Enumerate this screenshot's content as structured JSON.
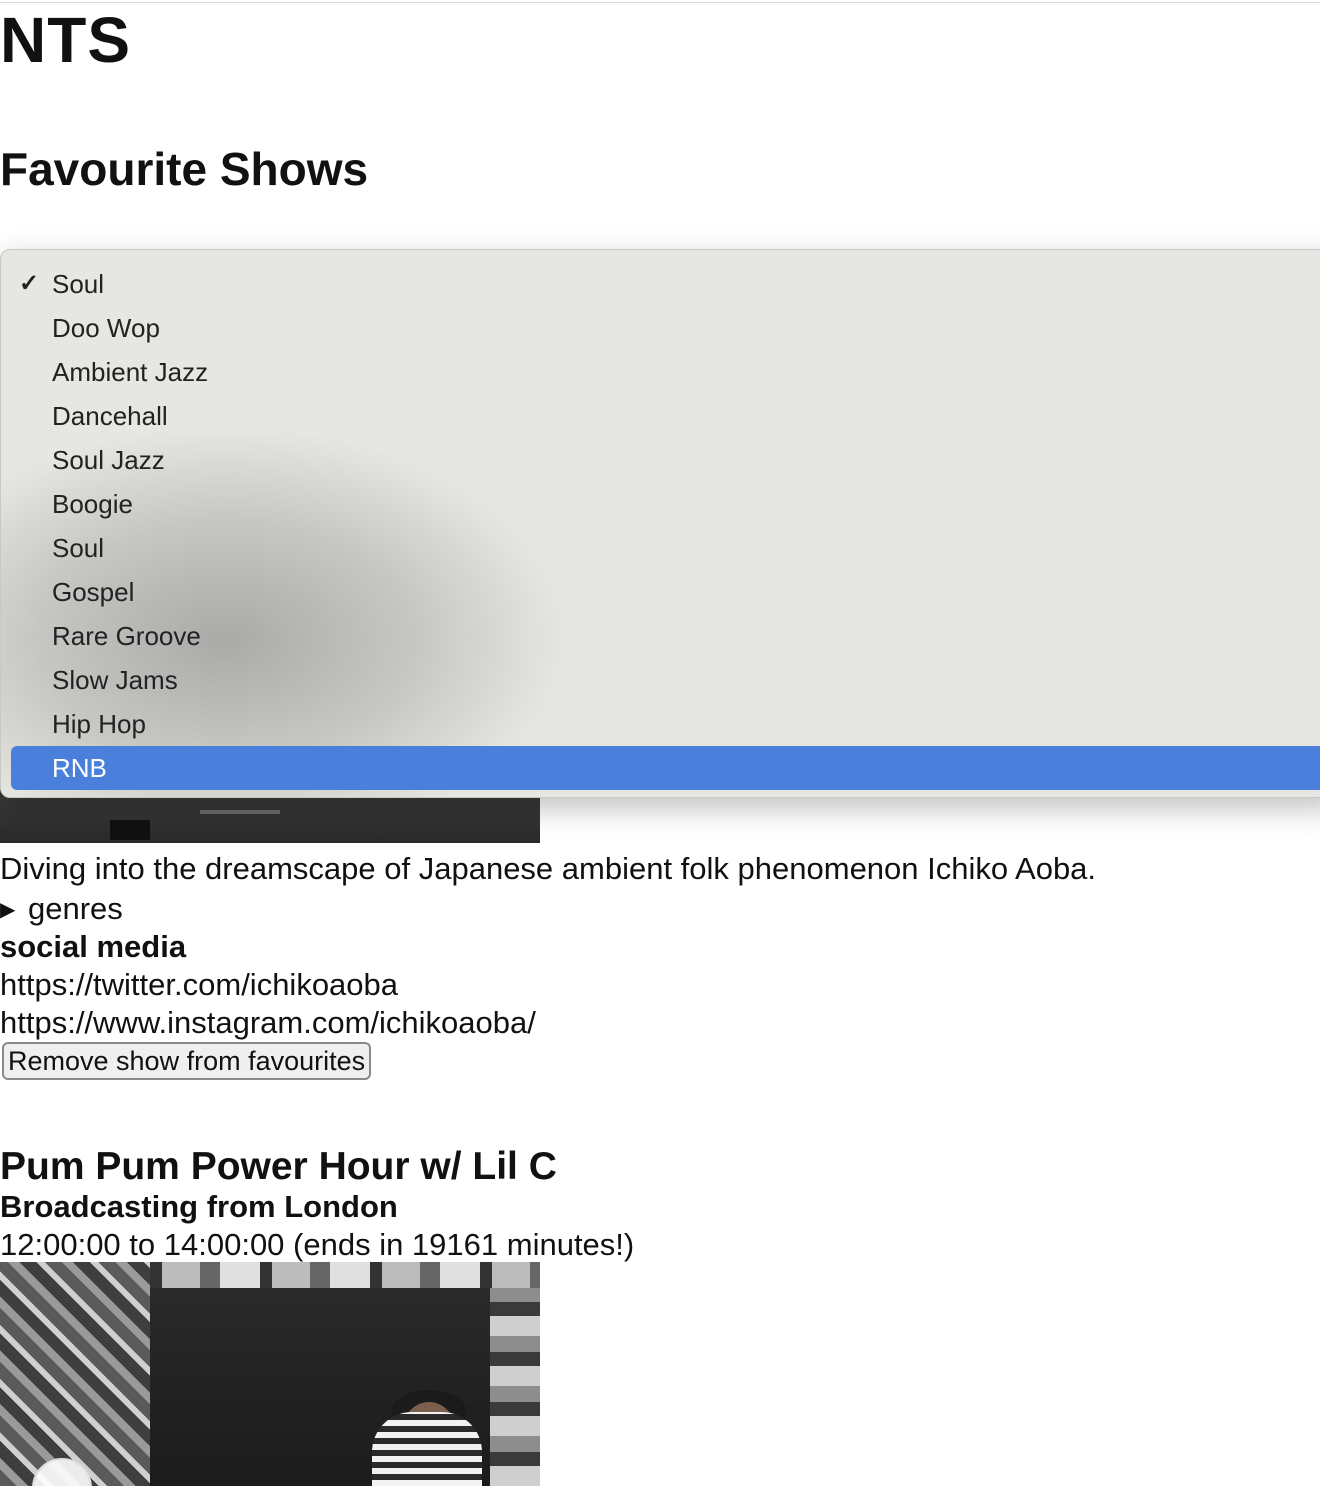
{
  "site": {
    "title": "NTS"
  },
  "section": {
    "title": "Favourite Shows"
  },
  "genre_select": {
    "selected_value": "Soul",
    "highlighted_value": "RNB",
    "options": [
      "Soul",
      "Doo Wop",
      "Ambient Jazz",
      "Dancehall",
      "Soul Jazz",
      "Boogie",
      "Soul",
      "Gospel",
      "Rare Groove",
      "Slow Jams",
      "Hip Hop",
      "RNB"
    ],
    "check_icon": "✓",
    "highlight_color": "#4a80dc"
  },
  "show1": {
    "description": "Diving into the dreamscape of Japanese ambient folk phenomenon Ichiko Aoba.",
    "genres_label": "genres",
    "social_heading": "social media",
    "social_links": [
      "https://twitter.com/ichikoaoba",
      "https://www.instagram.com/ichikoaoba/"
    ],
    "remove_label": "Remove show from favourites"
  },
  "show2": {
    "title": "Pum Pum Power Hour w/ Lil C",
    "location": "Broadcasting from London",
    "time": "12:00:00 to 14:00:00 (ends in 19161 minutes!)"
  }
}
